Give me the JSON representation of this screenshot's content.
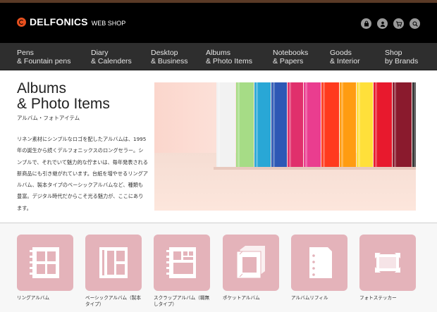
{
  "header": {
    "logo_text": "DELFONICS",
    "logo_sub": "WEB SHOP",
    "icons": [
      "bag-icon",
      "user-icon",
      "cart-icon",
      "search-icon"
    ]
  },
  "nav": [
    {
      "label": "Pens\n& Fountain pens"
    },
    {
      "label": "Diary\n& Calenders"
    },
    {
      "label": "Desktop\n& Business"
    },
    {
      "label": "Albums\n& Photo Items"
    },
    {
      "label": "Notebooks\n& Papers"
    },
    {
      "label": "Goods\n& Interior"
    },
    {
      "label": "Shop\nby Brands"
    }
  ],
  "main": {
    "title": "Albums\n& Photo Items",
    "subtitle": "アルバム・フォトアイテム",
    "description": "リネン素材にシンプルなロゴを配したアルバムは、1995年の誕生から続くデルフォニックスのロングセラー。シンプルで、それでいて魅力的な佇まいは、毎年発表される新商品にも引き継がれています。台紙を増やせるリングアルバム、製本タイプのベーシックアルバムなど、種類も豊富。デジタル時代だからこそ光る魅力が、ここにあります。"
  },
  "hero": {
    "book_colors": [
      "#f2f2f2",
      "#a6dc86",
      "#29a7d6",
      "#2d58b5",
      "#e0306c",
      "#ea3d8f",
      "#ff3a1e",
      "#ff9c12",
      "#ffe03a",
      "#e8192d",
      "#8a1a2d",
      "#2a2a2a"
    ]
  },
  "categories": [
    {
      "label": "リングアルバム",
      "icon": "ring-album-icon"
    },
    {
      "label": "ベーシックアルバム（製本タイプ）",
      "icon": "basic-album-icon"
    },
    {
      "label": "スクラップアルバム（糊無しタイプ）",
      "icon": "scrap-album-icon"
    },
    {
      "label": "ポケットアルバム",
      "icon": "pocket-album-icon"
    },
    {
      "label": "アルバムリフィル",
      "icon": "album-refill-icon"
    },
    {
      "label": "フォトステッカー",
      "icon": "photo-sticker-icon"
    }
  ],
  "colors": {
    "header_bg": "#000000",
    "nav_bg": "#2e2e2e",
    "category_tile": "#e4b3ba",
    "logo_accent": "#e8501e"
  }
}
